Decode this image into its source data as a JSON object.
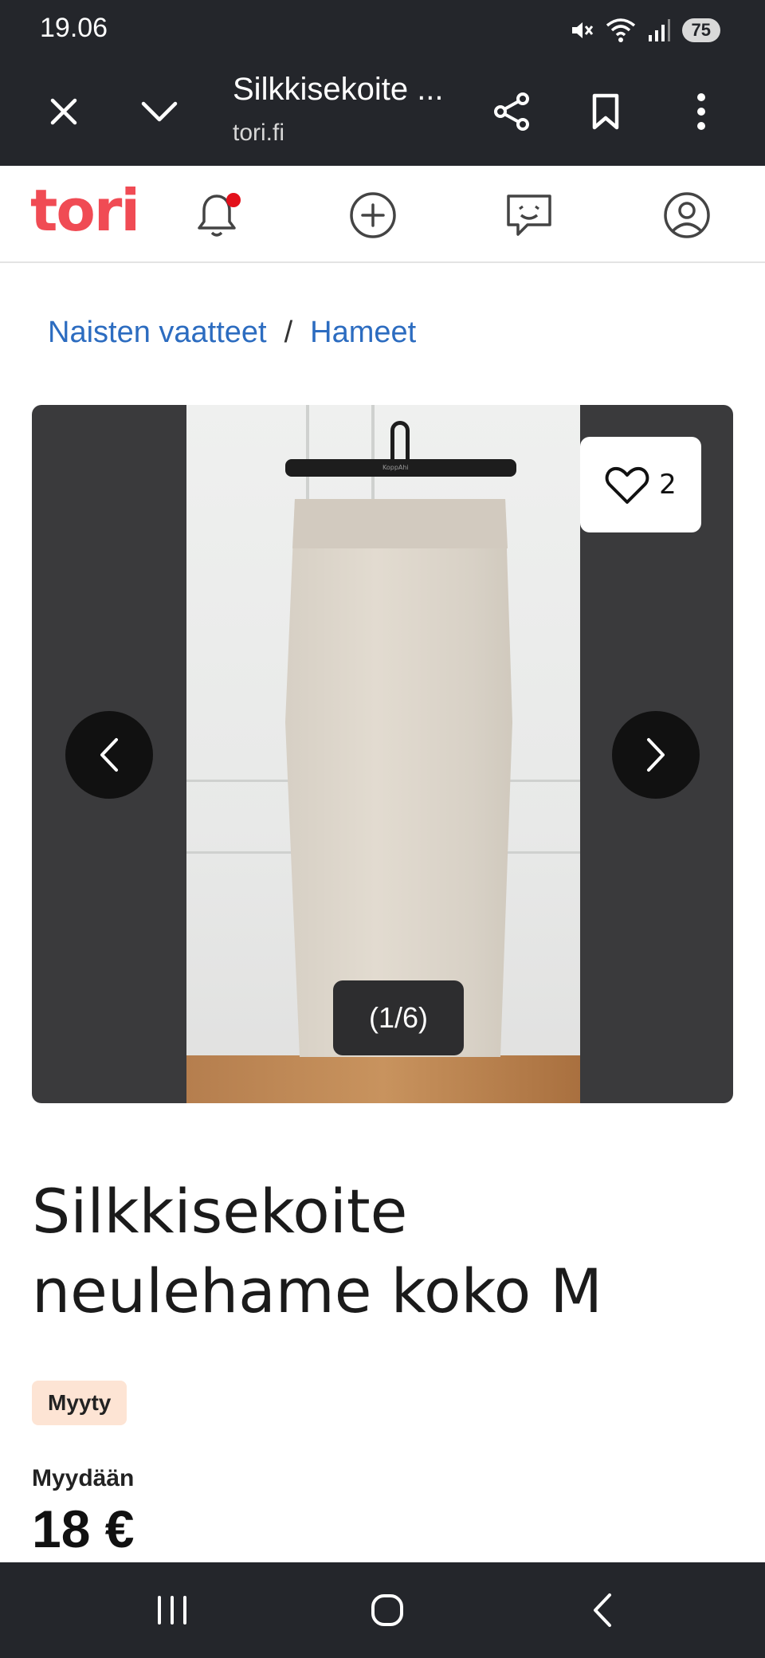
{
  "status_bar": {
    "time": "19.06",
    "battery": "75"
  },
  "browser": {
    "title": "Silkkisekoite ...",
    "domain": "tori.fi"
  },
  "site": {
    "logo": "tori"
  },
  "breadcrumb": {
    "items": [
      "Naisten vaatteet",
      "Hameet"
    ],
    "separator": "/"
  },
  "gallery": {
    "favorite_count": "2",
    "counter": "(1/6)",
    "hanger_brand": "KoppAhi"
  },
  "listing": {
    "title": "Silkkisekoite neulehame koko M",
    "status": "Myyty",
    "sale_label": "Myydään",
    "price": "18 €"
  },
  "colors": {
    "brand": "#f04b54",
    "link": "#2c6cc0",
    "sold_badge_bg": "#fde4d4",
    "dark_bar": "#24262b"
  }
}
